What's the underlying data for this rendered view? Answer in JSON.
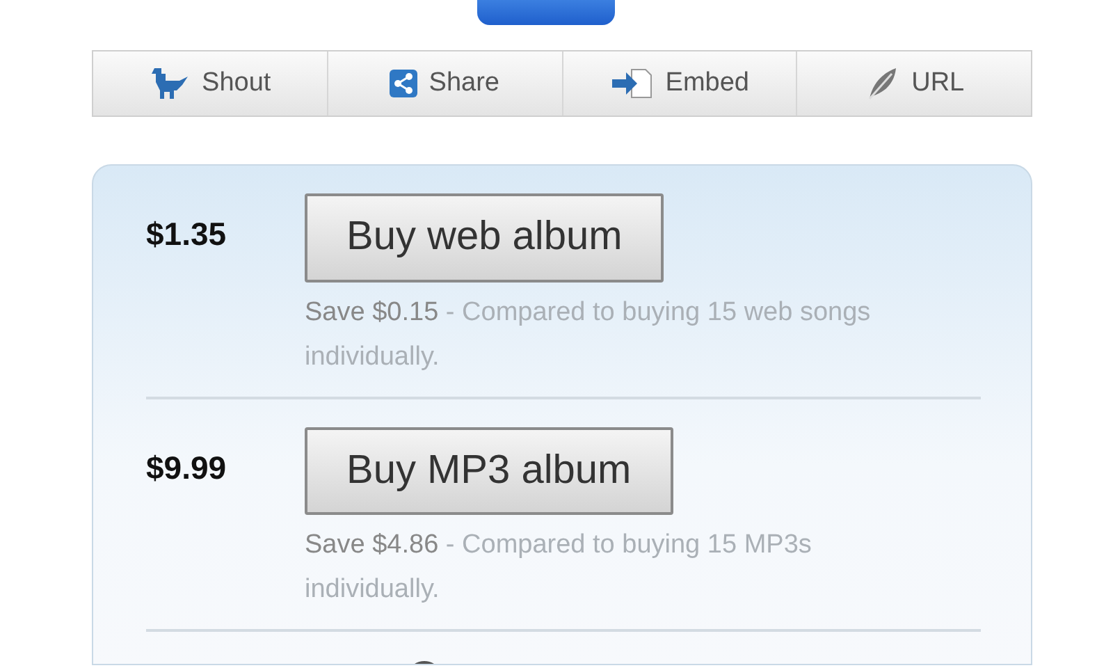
{
  "share_bar": [
    {
      "kind": "bird",
      "label": "Shout"
    },
    {
      "kind": "share",
      "label": "Share"
    },
    {
      "kind": "embed",
      "label": "Embed"
    },
    {
      "kind": "link",
      "label": "URL"
    }
  ],
  "offers": [
    {
      "price": "$1.35",
      "button": "Buy web album",
      "saving": "Save $0.15",
      "note": "- Compared to buying 15 web songs individually."
    },
    {
      "price": "$9.99",
      "button": "Buy MP3 album",
      "saving": "Save $4.86",
      "note": "- Compared to buying 15 MP3s individually."
    }
  ]
}
